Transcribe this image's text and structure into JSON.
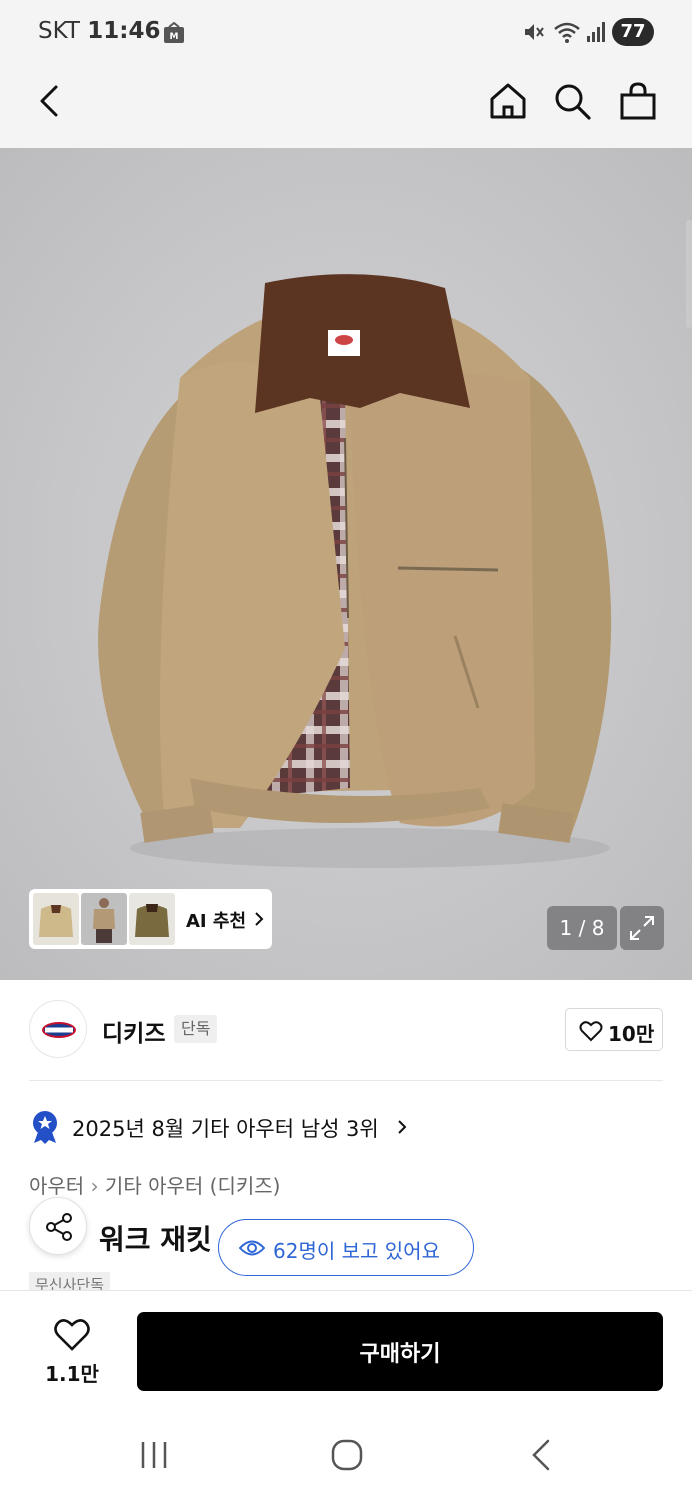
{
  "status_bar": {
    "carrier": "SKT",
    "time": "11:46",
    "battery": "77"
  },
  "product": {
    "image_counter": "1 / 8",
    "ai_recommend_label": "AI 추천",
    "brand_name": "디키즈",
    "brand_badge": "단독",
    "brand_likes": "10만",
    "ranking_text": "2025년 8월 기타 아우터 남성 3위",
    "breadcrumb": [
      "아우터",
      "기타 아우터 (디키즈)"
    ],
    "title_visible": "워크 재킷",
    "viewers_text": "62명이 보고 있어요",
    "exclusive_tag": "무신사단독"
  },
  "bottom_bar": {
    "wish_count": "1.1만",
    "buy_label": "구매하기"
  }
}
